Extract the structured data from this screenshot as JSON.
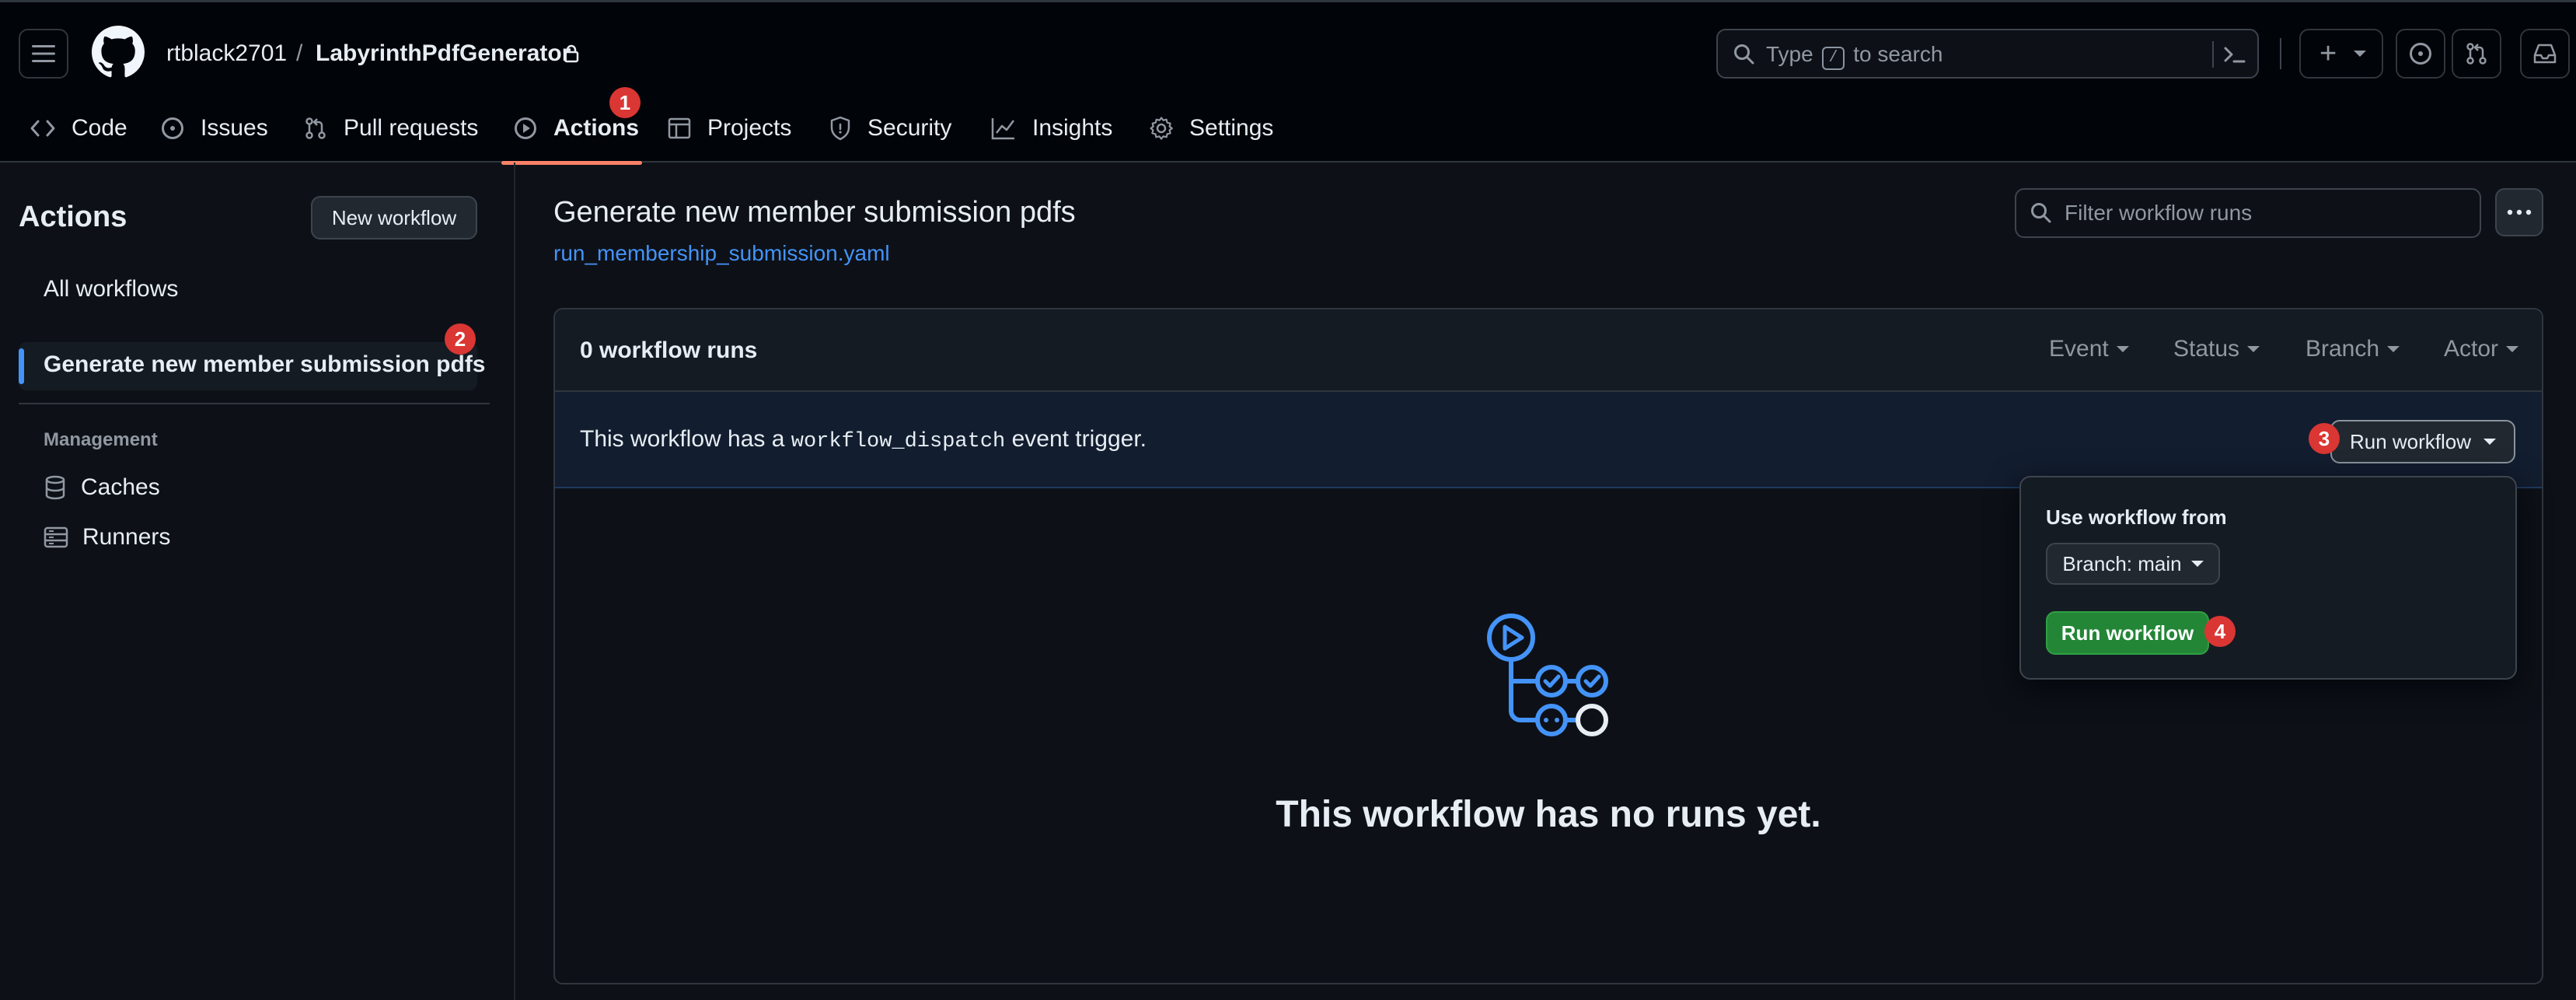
{
  "header": {
    "owner": "rtblack2701",
    "separator": "/",
    "repo": "LabyrinthPdfGenerator",
    "search": {
      "prefix": "Type",
      "key": "/",
      "suffix": "to search"
    },
    "plus_label": "+"
  },
  "repo_nav": {
    "tabs": [
      {
        "label": "Code",
        "icon": "code-icon"
      },
      {
        "label": "Issues",
        "icon": "issue-opened-icon"
      },
      {
        "label": "Pull requests",
        "icon": "git-pull-request-icon"
      },
      {
        "label": "Actions",
        "icon": "play-icon",
        "active": true
      },
      {
        "label": "Projects",
        "icon": "table-icon"
      },
      {
        "label": "Security",
        "icon": "shield-icon"
      },
      {
        "label": "Insights",
        "icon": "graph-icon"
      },
      {
        "label": "Settings",
        "icon": "gear-icon"
      }
    ]
  },
  "annotations": [
    "1",
    "2",
    "3",
    "4"
  ],
  "sidebar": {
    "title": "Actions",
    "new_workflow_label": "New workflow",
    "all_workflows_label": "All workflows",
    "selected_workflow_label": "Generate new member submission pdfs",
    "management_heading": "Management",
    "management_items": [
      {
        "label": "Caches",
        "icon": "database-icon"
      },
      {
        "label": "Runners",
        "icon": "server-icon"
      }
    ]
  },
  "main": {
    "title": "Generate new member submission pdfs",
    "workflow_file": "run_membership_submission.yaml",
    "filter_placeholder": "Filter workflow runs",
    "runs_count_label": "0 workflow runs",
    "filters": [
      "Event",
      "Status",
      "Branch",
      "Actor"
    ],
    "banner": {
      "text_before": "This workflow has a",
      "code": "workflow_dispatch",
      "text_after": "event trigger."
    },
    "run_workflow_button_label": "Run workflow",
    "dropdown": {
      "heading": "Use workflow from",
      "branch_label": "Branch: main",
      "run_button_label": "Run workflow"
    },
    "empty_state_text": "This workflow has no runs yet."
  },
  "colors": {
    "accent_blue": "#4493f8",
    "annotation_red": "#da3633",
    "green_button": "#238636",
    "active_tab_underline": "#f78166"
  }
}
